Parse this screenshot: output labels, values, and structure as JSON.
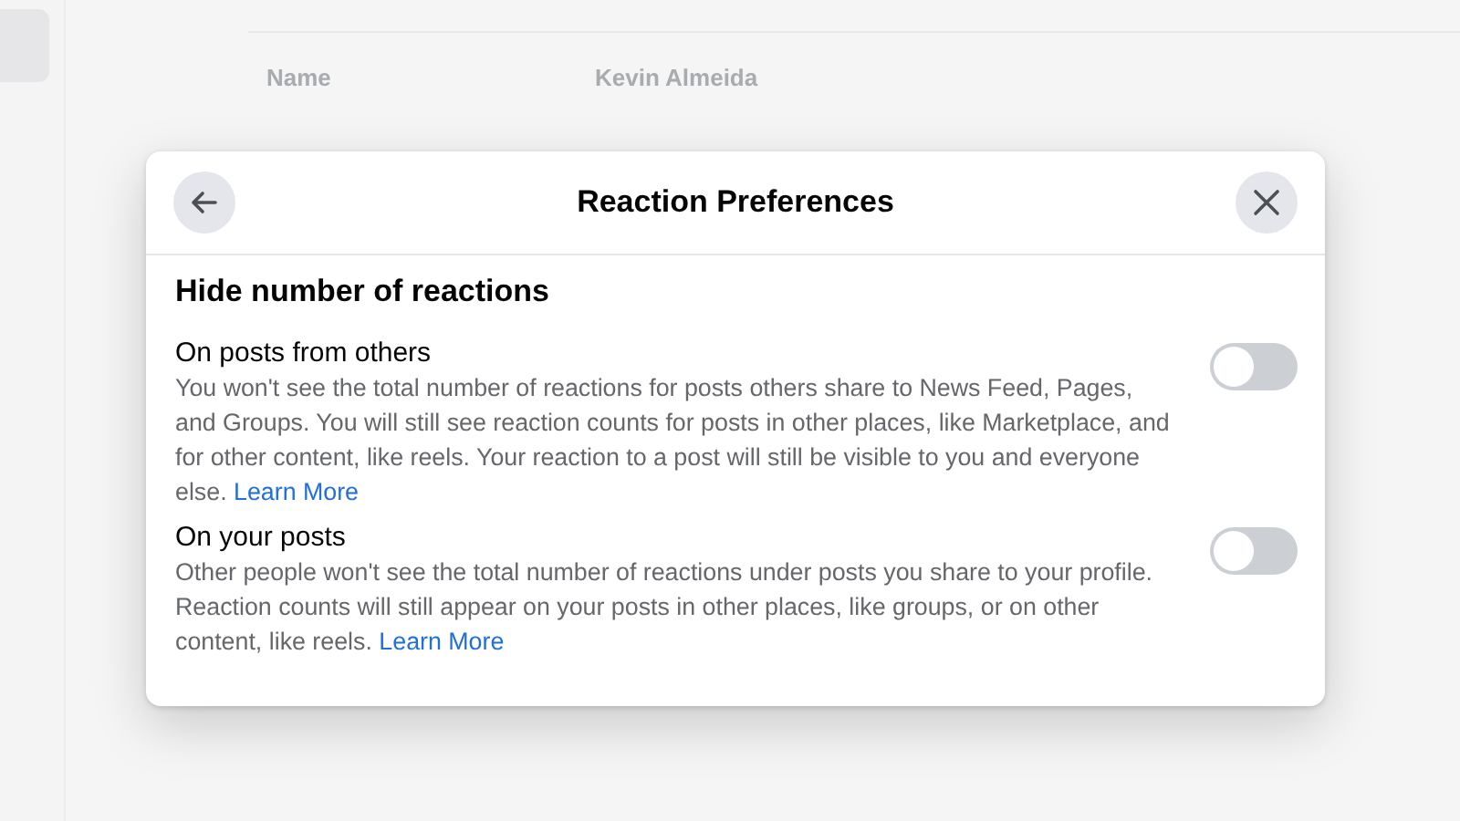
{
  "background": {
    "rows": [
      {
        "label": "Name",
        "value": "Kevin Almeida"
      }
    ]
  },
  "dialog": {
    "title": "Reaction Preferences",
    "section_title": "Hide number of reactions",
    "settings": [
      {
        "title": "On posts from others",
        "description": "You won't see the total number of reactions for posts others share to News Feed, Pages, and Groups. You will still see reaction counts for posts in other places, like Marketplace, and for other content, like reels. Your reaction to a post will still be visible to you and everyone else.",
        "link": "Learn More",
        "on": false
      },
      {
        "title": "On your posts",
        "description": "Other people won't see the total number of reactions under posts you share to your profile. Reaction counts will still appear on your posts in other places, like groups, or on other content, like reels.",
        "link": "Learn More",
        "on": false
      }
    ]
  }
}
